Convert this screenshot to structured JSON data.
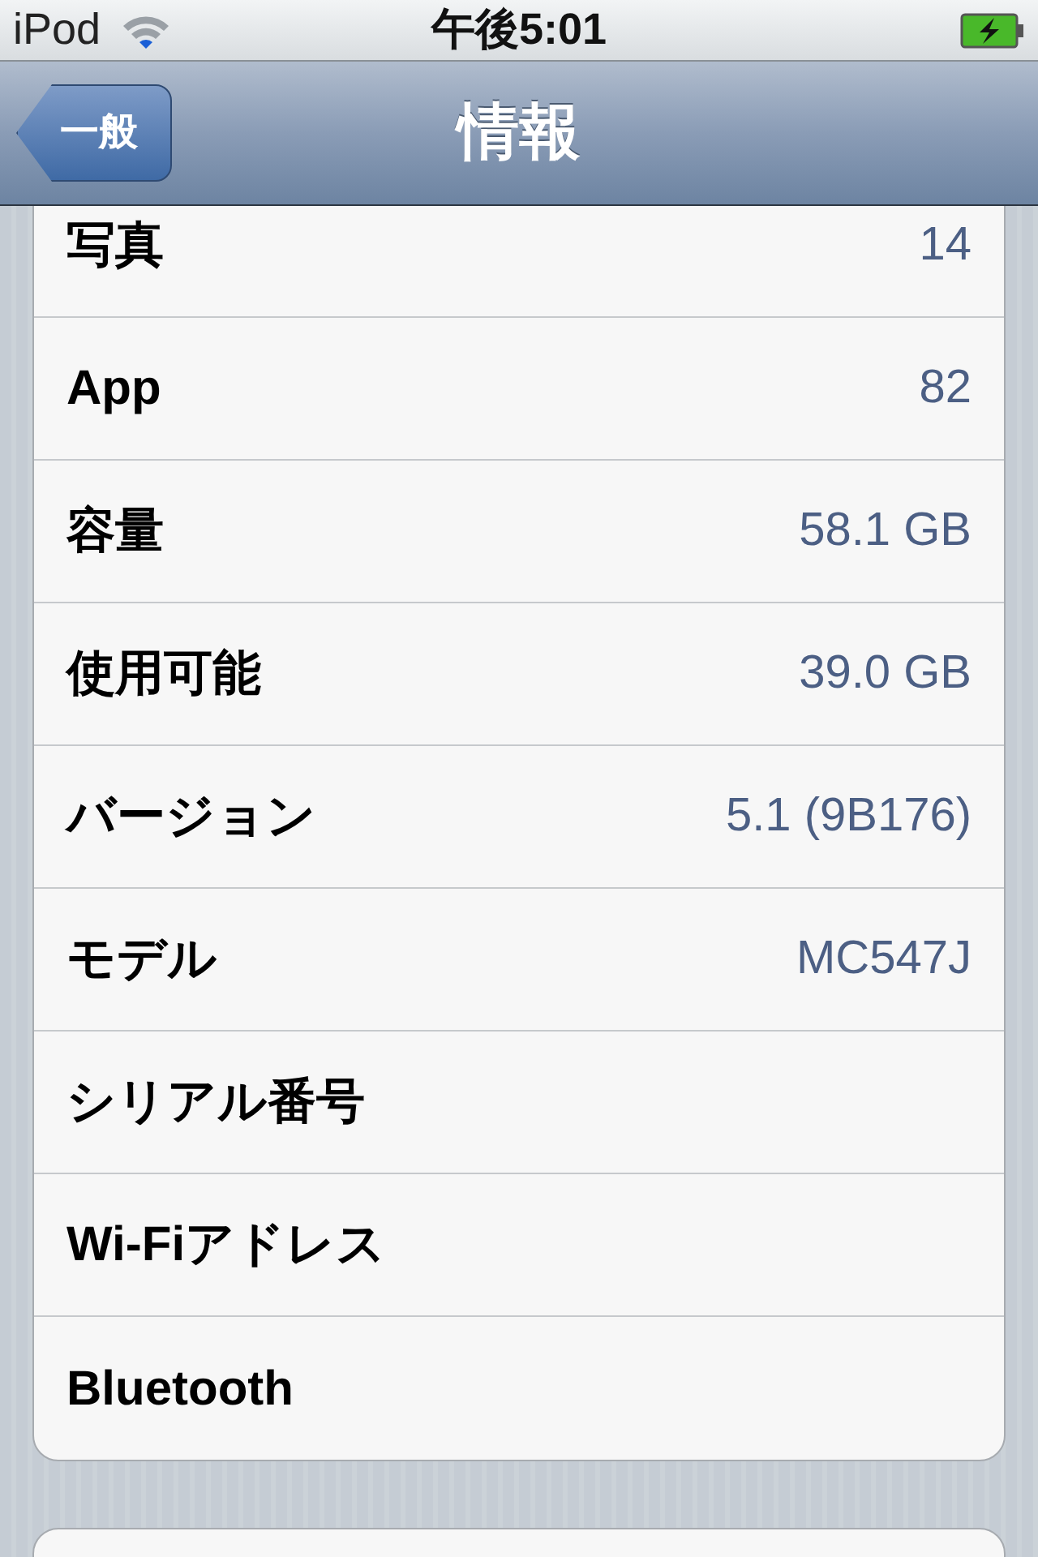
{
  "status_bar": {
    "carrier": "iPod",
    "time": "午後5:01"
  },
  "nav_bar": {
    "back_button": "一般",
    "title": "情報"
  },
  "rows": [
    {
      "label": "写真",
      "value": "14"
    },
    {
      "label": "App",
      "value": "82"
    },
    {
      "label": "容量",
      "value": "58.1 GB"
    },
    {
      "label": "使用可能",
      "value": "39.0 GB"
    },
    {
      "label": "バージョン",
      "value": "5.1 (9B176)"
    },
    {
      "label": "モデル",
      "value": "MC547J"
    },
    {
      "label": "シリアル番号"
    },
    {
      "label": "Wi-Fiアドレス"
    },
    {
      "label": "Bluetooth"
    }
  ]
}
